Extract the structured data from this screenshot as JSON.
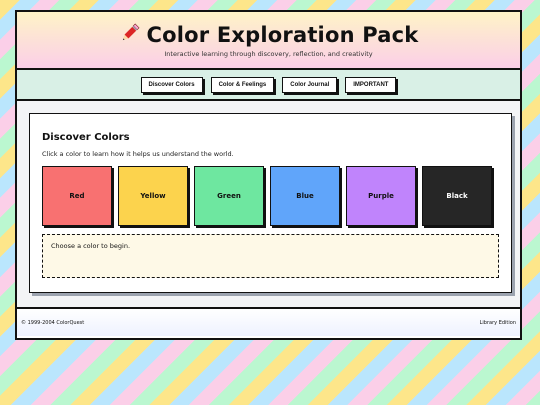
{
  "header": {
    "icon": "pencil-icon",
    "title": "Color Exploration Pack",
    "subtitle": "Interactive learning through discovery, reflection, and creativity"
  },
  "nav": {
    "items": [
      {
        "label": "Discover Colors"
      },
      {
        "label": "Color & Feelings"
      },
      {
        "label": "Color Journal"
      },
      {
        "label": "IMPORTANT"
      }
    ]
  },
  "discover": {
    "title": "Discover Colors",
    "description": "Click a color to learn how it helps us understand the world.",
    "swatches": [
      {
        "label": "Red",
        "color": "#f87171"
      },
      {
        "label": "Yellow",
        "color": "#fcd34d"
      },
      {
        "label": "Green",
        "color": "#6ee7a0"
      },
      {
        "label": "Blue",
        "color": "#60a5fa"
      },
      {
        "label": "Purple",
        "color": "#c084fc"
      },
      {
        "label": "Black",
        "color": "#262626"
      }
    ],
    "result_text": "Choose a color to begin."
  },
  "footer": {
    "copyright": "© 1999-2004 ColorQuest",
    "edition": "Library Edition"
  }
}
